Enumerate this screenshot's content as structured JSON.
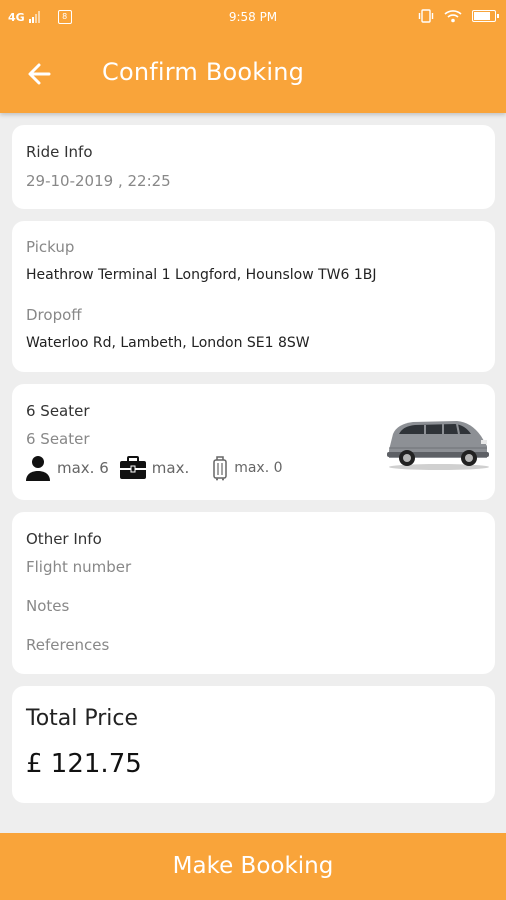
{
  "status_bar": {
    "network": "4G",
    "time": "9:58 PM",
    "sim_icon_text": "8",
    "battery_level": 0.85
  },
  "header": {
    "title": "Confirm Booking",
    "back_icon": "arrow-left-icon"
  },
  "ride_info": {
    "label": "Ride Info",
    "datetime": "29-10-2019 , 22:25"
  },
  "locations": {
    "pickup_label": "Pickup",
    "pickup_value": "Heathrow Terminal 1 Longford, Hounslow TW6 1BJ",
    "dropoff_label": "Dropoff",
    "dropoff_value": "Waterloo Rd, Lambeth, London SE1 8SW"
  },
  "vehicle": {
    "name": "6 Seater",
    "type": "6 Seater",
    "passengers": "max. 6",
    "luggage": "max.",
    "hand_luggage": "max. 0"
  },
  "other_info": {
    "label": "Other Info",
    "flight_number": "Flight number",
    "notes": "Notes",
    "references": "References"
  },
  "price": {
    "label": "Total Price",
    "value": "£ 121.75"
  },
  "cta": {
    "label": "Make Booking"
  },
  "colors": {
    "accent": "#f9a43a",
    "background": "#eeeeee"
  }
}
